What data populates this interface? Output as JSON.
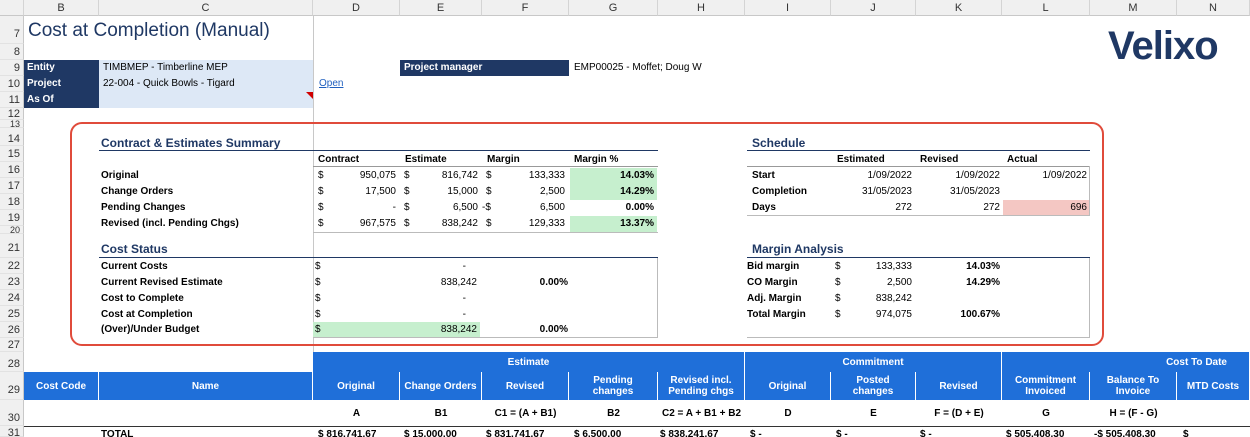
{
  "columns": [
    "B",
    "C",
    "D",
    "E",
    "F",
    "G",
    "H",
    "I",
    "J",
    "K",
    "L",
    "M",
    "N"
  ],
  "rows": [
    "7",
    "8",
    "9",
    "10",
    "11",
    "12",
    "13",
    "14",
    "15",
    "16",
    "17",
    "18",
    "19",
    "20",
    "21",
    "22",
    "23",
    "24",
    "25",
    "26",
    "27",
    "28",
    "29",
    "30",
    "31"
  ],
  "title": "Cost at Completion (Manual)",
  "logo": "Velixo",
  "header": {
    "entity_label": "Entity",
    "entity_value": "TIMBMEP - Timberline MEP",
    "project_label": "Project",
    "project_value": "22-004 - Quick Bowls - Tigard",
    "asof_label": "As Of",
    "asof_value": "",
    "open_link": "Open",
    "pm_label": "Project manager",
    "pm_value": "EMP00025 - Moffet; Doug W"
  },
  "contract_summary": {
    "title": "Contract & Estimates Summary",
    "columns": [
      "Contract",
      "Estimate",
      "Margin",
      "Margin %"
    ],
    "rows": [
      {
        "label": "Original",
        "contract": "950,075",
        "estimate": "816,742",
        "margin_sign": "$",
        "margin": "133,333",
        "pct": "14.03%"
      },
      {
        "label": "Change Orders",
        "contract": "17,500",
        "estimate": "15,000",
        "margin_sign": "$",
        "margin": "2,500",
        "pct": "14.29%"
      },
      {
        "label": "Pending Changes",
        "contract": "-",
        "estimate": "6,500",
        "margin_sign": "-$",
        "margin": "6,500",
        "pct": "0.00%"
      },
      {
        "label": "Revised (incl. Pending Chgs)",
        "contract": "967,575",
        "estimate": "838,242",
        "margin_sign": "$",
        "margin": "129,333",
        "pct": "13.37%"
      }
    ]
  },
  "cost_status": {
    "title": "Cost Status",
    "rows": [
      {
        "label": "Current Costs",
        "value": "-",
        "pct": ""
      },
      {
        "label": "Current Revised Estimate",
        "value": "838,242",
        "pct": "0.00%"
      },
      {
        "label": "Cost to Complete",
        "value": "-",
        "pct": ""
      },
      {
        "label": "Cost at Completion",
        "value": "-",
        "pct": ""
      },
      {
        "label": "(Over)/Under Budget",
        "value": "838,242",
        "pct": "0.00%"
      }
    ]
  },
  "schedule": {
    "title": "Schedule",
    "columns": [
      "Estimated",
      "Revised",
      "Actual"
    ],
    "rows": [
      {
        "label": "Start",
        "estimated": "1/09/2022",
        "revised": "1/09/2022",
        "actual": "1/09/2022"
      },
      {
        "label": "Completion",
        "estimated": "31/05/2023",
        "revised": "31/05/2023",
        "actual": ""
      },
      {
        "label": "Days",
        "estimated": "272",
        "revised": "272",
        "actual": "696"
      }
    ]
  },
  "margin_analysis": {
    "title": "Margin Analysis",
    "rows": [
      {
        "label": "Bid margin",
        "value": "133,333",
        "pct": "14.03%"
      },
      {
        "label": "CO Margin",
        "value": "2,500",
        "pct": "14.29%"
      },
      {
        "label": "Adj. Margin",
        "value": "838,242",
        "pct": ""
      },
      {
        "label": "Total Margin",
        "value": "974,075",
        "pct": "100.67%"
      }
    ]
  },
  "grid": {
    "groups": [
      "Estimate",
      "Commitment",
      "Cost To Date"
    ],
    "headers": [
      "Cost Code",
      "Name",
      "Original",
      "Change Orders",
      "Revised",
      "Pending changes",
      "Revised incl. Pending chgs",
      "Original",
      "Posted changes",
      "Revised",
      "Commitment Invoiced",
      "Balance To Invoice",
      "MTD Costs"
    ],
    "formulas": [
      "",
      "",
      "A",
      "B1",
      "C1 = (A + B1)",
      "B2",
      "C2 = A + B1 + B2",
      "D",
      "E",
      "F = (D + E)",
      "G",
      "H = (F - G)",
      ""
    ],
    "total_label": "TOTAL",
    "total_values": [
      "$ 816,741.67",
      "$ 15,000.00",
      "$ 831,741.67",
      "$ 6,500.00",
      "$ 838,241.67",
      "$ -",
      "$ -",
      "$ -",
      "$ 505,408.30",
      "-$ 505,408.30",
      "$"
    ]
  },
  "currency": "$",
  "colors": {
    "navy": "#1f3864",
    "band_blue": "#1f6fd9",
    "green": "#c6efce",
    "pink": "#f4c7c3",
    "input_blue": "#dde8f6",
    "highlight_red": "#e04b3b"
  }
}
